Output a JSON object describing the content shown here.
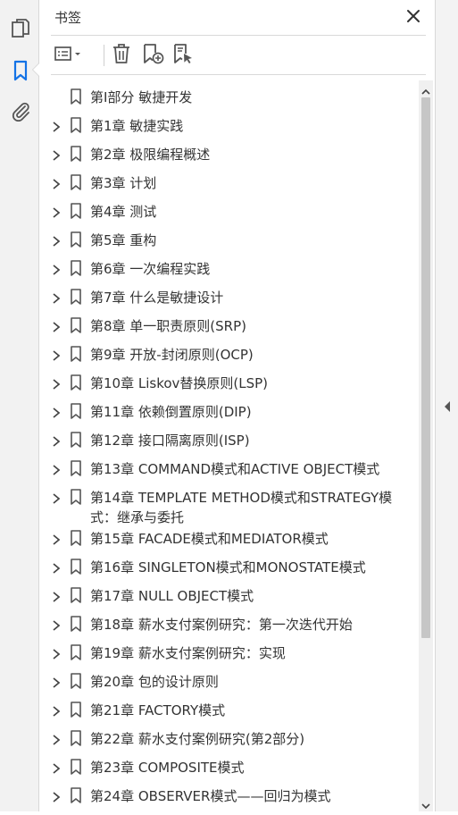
{
  "panel": {
    "title": "书签"
  },
  "icons": {
    "rail": [
      "pages-icon",
      "bookmarks-icon",
      "attachments-icon"
    ],
    "toolbar": [
      "options-menu-icon",
      "delete-icon",
      "new-bookmark-icon",
      "new-bookmark-from-structure-icon"
    ]
  },
  "colors": {
    "accent": "#1473e6",
    "text": "#333333",
    "icon": "#555555"
  },
  "bookmarks": [
    {
      "label": "第I部分 敏捷开发",
      "expandable": false
    },
    {
      "label": "第1章 敏捷实践",
      "expandable": true
    },
    {
      "label": "第2章 极限编程概述",
      "expandable": true
    },
    {
      "label": "第3章 计划",
      "expandable": true
    },
    {
      "label": "第4章 测试",
      "expandable": true
    },
    {
      "label": "第5章 重构",
      "expandable": true
    },
    {
      "label": "第6章 一次编程实践",
      "expandable": true
    },
    {
      "label": "第7章 什么是敏捷设计",
      "expandable": true
    },
    {
      "label": "第8章 单一职责原则(SRP)",
      "expandable": true
    },
    {
      "label": "第9章 开放-封闭原则(OCP)",
      "expandable": true
    },
    {
      "label": "第10章 Liskov替换原则(LSP)",
      "expandable": true
    },
    {
      "label": "第11章 依赖倒置原则(DIP)",
      "expandable": true
    },
    {
      "label": "第12章 接口隔离原则(ISP)",
      "expandable": true
    },
    {
      "label": "第13章 COMMAND模式和ACTIVE OBJECT模式",
      "expandable": true
    },
    {
      "label": "第14章 TEMPLATE METHOD模式和STRATEGY模式：继承与委托",
      "expandable": true
    },
    {
      "label": "第15章 FACADE模式和MEDIATOR模式",
      "expandable": true
    },
    {
      "label": "第16章 SINGLETON模式和MONOSTATE模式",
      "expandable": true
    },
    {
      "label": "第17章 NULL OBJECT模式",
      "expandable": true
    },
    {
      "label": "第18章 薪水支付案例研究：第一次迭代开始",
      "expandable": true
    },
    {
      "label": "第19章 薪水支付案例研究：实现",
      "expandable": true
    },
    {
      "label": "第20章 包的设计原则",
      "expandable": true
    },
    {
      "label": "第21章 FACTORY模式",
      "expandable": true
    },
    {
      "label": "第22章 薪水支付案例研究(第2部分)",
      "expandable": true
    },
    {
      "label": "第23章 COMPOSITE模式",
      "expandable": true
    },
    {
      "label": "第24章 OBSERVER模式——回归为模式",
      "expandable": true
    }
  ]
}
